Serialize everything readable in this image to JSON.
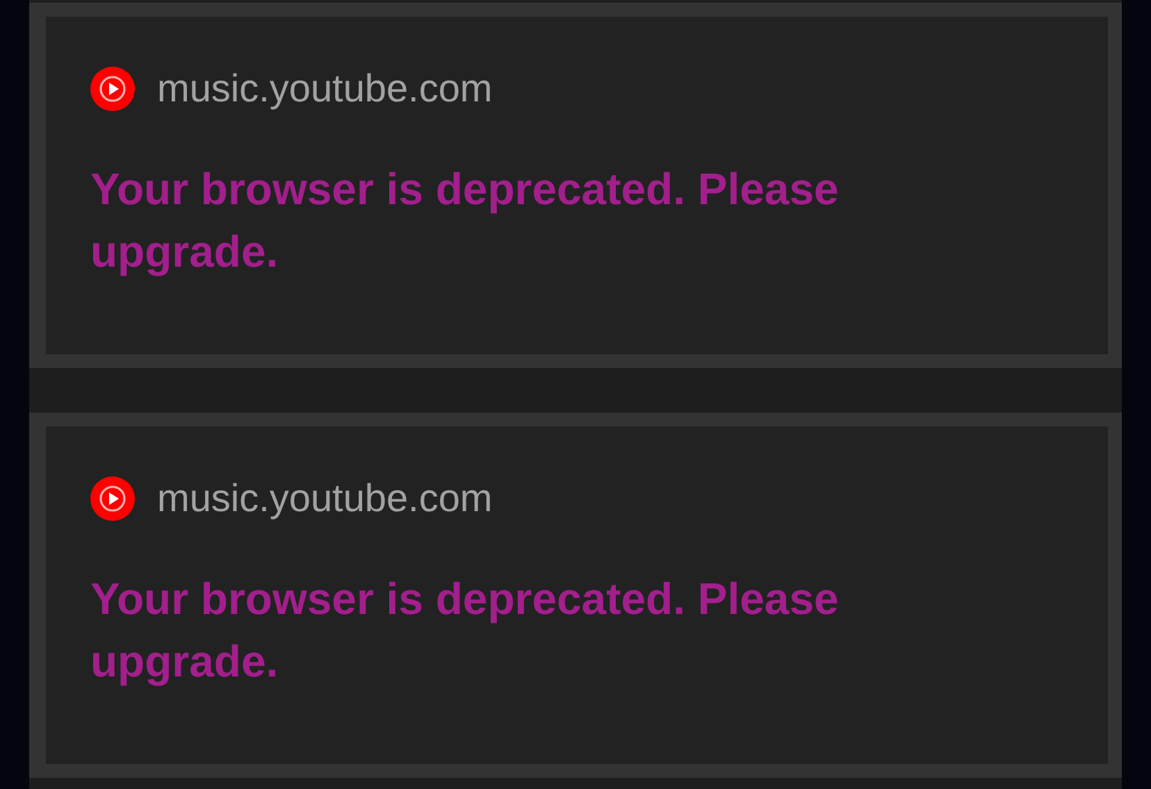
{
  "notifications": [
    {
      "site": "music.youtube.com",
      "message": "Your browser is deprecated. Please upgrade."
    },
    {
      "site": "music.youtube.com",
      "message": "Your browser is deprecated. Please upgrade."
    }
  ]
}
